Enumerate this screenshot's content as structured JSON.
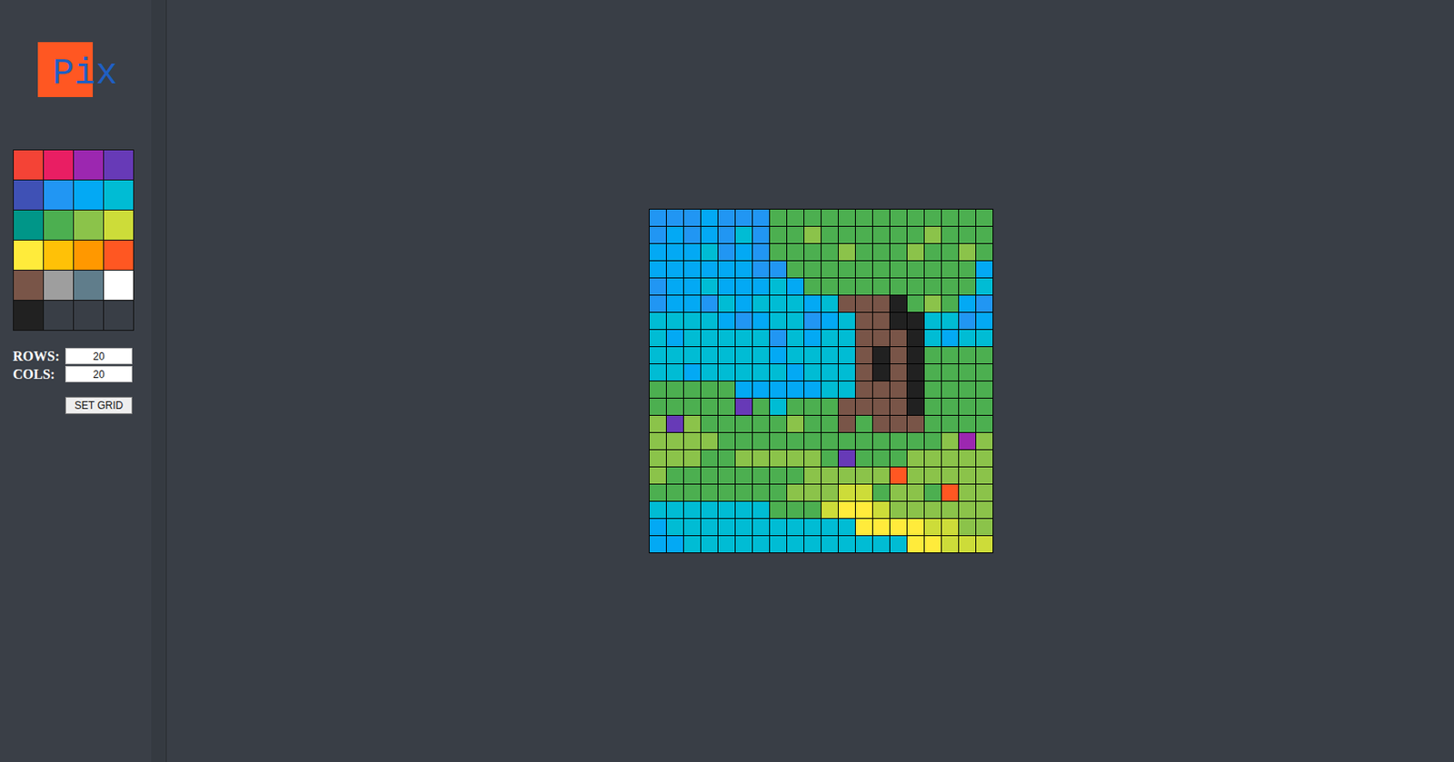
{
  "logo": {
    "text": "Pix"
  },
  "palette": [
    {
      "color": "#f44336"
    },
    {
      "color": "#e91e63"
    },
    {
      "color": "#9c27b0"
    },
    {
      "color": "#673ab7"
    },
    {
      "color": "#3f51b5"
    },
    {
      "color": "#2196f3"
    },
    {
      "color": "#03a9f4"
    },
    {
      "color": "#00bcd4"
    },
    {
      "color": "#009688"
    },
    {
      "color": "#4caf50"
    },
    {
      "color": "#8bc34a"
    },
    {
      "color": "#cddc39"
    },
    {
      "color": "#ffeb3b"
    },
    {
      "color": "#ffc107"
    },
    {
      "color": "#ff9800"
    },
    {
      "color": "#ff5722"
    },
    {
      "color": "#795548"
    },
    {
      "color": "#9e9e9e"
    },
    {
      "color": "#607d8b"
    },
    {
      "color": "#ffffff"
    },
    {
      "color": "#212121"
    },
    {
      "color": "#393e46"
    },
    {
      "color": "#393e46"
    },
    {
      "color": "#393e46"
    }
  ],
  "settings": {
    "rows_label": "ROWS:",
    "rows_value": "20",
    "cols_label": "COLS:",
    "cols_value": "20",
    "button": "SET GRID"
  },
  "grid": {
    "rows": [
      [
        "#2196f3",
        "#2196f3",
        "#2196f3",
        "#03a9f4",
        "#2196f3",
        "#2196f3",
        "#2196f3",
        "#4caf50",
        "#4caf50",
        "#4caf50",
        "#4caf50",
        "#4caf50",
        "#4caf50",
        "#4caf50",
        "#4caf50",
        "#4caf50",
        "#4caf50",
        "#4caf50",
        "#4caf50",
        "#4caf50"
      ],
      [
        "#2196f3",
        "#03a9f4",
        "#2196f3",
        "#03a9f4",
        "#2196f3",
        "#00bcd4",
        "#2196f3",
        "#4caf50",
        "#4caf50",
        "#8bc34a",
        "#4caf50",
        "#4caf50",
        "#4caf50",
        "#4caf50",
        "#4caf50",
        "#4caf50",
        "#8bc34a",
        "#4caf50",
        "#4caf50",
        "#4caf50"
      ],
      [
        "#03a9f4",
        "#03a9f4",
        "#03a9f4",
        "#00bcd4",
        "#2196f3",
        "#03a9f4",
        "#2196f3",
        "#4caf50",
        "#4caf50",
        "#4caf50",
        "#4caf50",
        "#8bc34a",
        "#4caf50",
        "#4caf50",
        "#4caf50",
        "#8bc34a",
        "#4caf50",
        "#4caf50",
        "#8bc34a",
        "#4caf50"
      ],
      [
        "#03a9f4",
        "#03a9f4",
        "#03a9f4",
        "#03a9f4",
        "#03a9f4",
        "#03a9f4",
        "#2196f3",
        "#2196f3",
        "#4caf50",
        "#4caf50",
        "#4caf50",
        "#4caf50",
        "#4caf50",
        "#4caf50",
        "#4caf50",
        "#4caf50",
        "#4caf50",
        "#4caf50",
        "#4caf50",
        "#03a9f4"
      ],
      [
        "#2196f3",
        "#03a9f4",
        "#03a9f4",
        "#00bcd4",
        "#03a9f4",
        "#03a9f4",
        "#03a9f4",
        "#00bcd4",
        "#03a9f4",
        "#4caf50",
        "#4caf50",
        "#4caf50",
        "#4caf50",
        "#4caf50",
        "#4caf50",
        "#4caf50",
        "#4caf50",
        "#4caf50",
        "#4caf50",
        "#00bcd4"
      ],
      [
        "#2196f3",
        "#03a9f4",
        "#03a9f4",
        "#2196f3",
        "#00bcd4",
        "#03a9f4",
        "#00bcd4",
        "#00bcd4",
        "#00bcd4",
        "#03a9f4",
        "#00bcd4",
        "#795548",
        "#795548",
        "#795548",
        "#212121",
        "#4caf50",
        "#8bc34a",
        "#4caf50",
        "#03a9f4",
        "#2196f3"
      ],
      [
        "#00bcd4",
        "#00bcd4",
        "#00bcd4",
        "#00bcd4",
        "#03a9f4",
        "#2196f3",
        "#03a9f4",
        "#00bcd4",
        "#00bcd4",
        "#2196f3",
        "#03a9f4",
        "#00bcd4",
        "#795548",
        "#795548",
        "#212121",
        "#212121",
        "#00bcd4",
        "#00bcd4",
        "#2196f3",
        "#03a9f4"
      ],
      [
        "#00bcd4",
        "#03a9f4",
        "#00bcd4",
        "#00bcd4",
        "#00bcd4",
        "#00bcd4",
        "#00bcd4",
        "#2196f3",
        "#00bcd4",
        "#03a9f4",
        "#00bcd4",
        "#00bcd4",
        "#795548",
        "#795548",
        "#795548",
        "#212121",
        "#00bcd4",
        "#03a9f4",
        "#00bcd4",
        "#00bcd4"
      ],
      [
        "#00bcd4",
        "#00bcd4",
        "#00bcd4",
        "#00bcd4",
        "#00bcd4",
        "#00bcd4",
        "#00bcd4",
        "#03a9f4",
        "#00bcd4",
        "#00bcd4",
        "#00bcd4",
        "#00bcd4",
        "#795548",
        "#212121",
        "#795548",
        "#212121",
        "#4caf50",
        "#4caf50",
        "#4caf50",
        "#4caf50"
      ],
      [
        "#00bcd4",
        "#00bcd4",
        "#03a9f4",
        "#00bcd4",
        "#00bcd4",
        "#00bcd4",
        "#00bcd4",
        "#00bcd4",
        "#03a9f4",
        "#00bcd4",
        "#00bcd4",
        "#00bcd4",
        "#795548",
        "#212121",
        "#795548",
        "#212121",
        "#4caf50",
        "#4caf50",
        "#4caf50",
        "#4caf50"
      ],
      [
        "#4caf50",
        "#4caf50",
        "#4caf50",
        "#4caf50",
        "#4caf50",
        "#03a9f4",
        "#03a9f4",
        "#03a9f4",
        "#03a9f4",
        "#03a9f4",
        "#00bcd4",
        "#00bcd4",
        "#795548",
        "#795548",
        "#795548",
        "#212121",
        "#4caf50",
        "#4caf50",
        "#4caf50",
        "#4caf50"
      ],
      [
        "#4caf50",
        "#4caf50",
        "#4caf50",
        "#4caf50",
        "#4caf50",
        "#673ab7",
        "#4caf50",
        "#00bcd4",
        "#4caf50",
        "#4caf50",
        "#4caf50",
        "#795548",
        "#795548",
        "#795548",
        "#795548",
        "#212121",
        "#4caf50",
        "#4caf50",
        "#4caf50",
        "#4caf50"
      ],
      [
        "#8bc34a",
        "#673ab7",
        "#8bc34a",
        "#4caf50",
        "#4caf50",
        "#4caf50",
        "#4caf50",
        "#4caf50",
        "#8bc34a",
        "#4caf50",
        "#4caf50",
        "#795548",
        "#4caf50",
        "#795548",
        "#795548",
        "#795548",
        "#4caf50",
        "#4caf50",
        "#4caf50",
        "#4caf50"
      ],
      [
        "#8bc34a",
        "#8bc34a",
        "#8bc34a",
        "#8bc34a",
        "#4caf50",
        "#4caf50",
        "#4caf50",
        "#4caf50",
        "#4caf50",
        "#4caf50",
        "#4caf50",
        "#4caf50",
        "#4caf50",
        "#4caf50",
        "#4caf50",
        "#4caf50",
        "#4caf50",
        "#8bc34a",
        "#9c27b0",
        "#8bc34a"
      ],
      [
        "#8bc34a",
        "#8bc34a",
        "#8bc34a",
        "#4caf50",
        "#4caf50",
        "#8bc34a",
        "#8bc34a",
        "#8bc34a",
        "#8bc34a",
        "#8bc34a",
        "#4caf50",
        "#673ab7",
        "#4caf50",
        "#4caf50",
        "#4caf50",
        "#8bc34a",
        "#8bc34a",
        "#8bc34a",
        "#8bc34a",
        "#8bc34a"
      ],
      [
        "#8bc34a",
        "#4caf50",
        "#4caf50",
        "#4caf50",
        "#4caf50",
        "#4caf50",
        "#4caf50",
        "#4caf50",
        "#4caf50",
        "#8bc34a",
        "#8bc34a",
        "#8bc34a",
        "#8bc34a",
        "#8bc34a",
        "#ff5722",
        "#8bc34a",
        "#8bc34a",
        "#8bc34a",
        "#8bc34a",
        "#8bc34a"
      ],
      [
        "#4caf50",
        "#4caf50",
        "#4caf50",
        "#4caf50",
        "#4caf50",
        "#4caf50",
        "#4caf50",
        "#4caf50",
        "#8bc34a",
        "#8bc34a",
        "#8bc34a",
        "#cddc39",
        "#cddc39",
        "#4caf50",
        "#8bc34a",
        "#8bc34a",
        "#4caf50",
        "#ff5722",
        "#8bc34a",
        "#8bc34a"
      ],
      [
        "#00bcd4",
        "#00bcd4",
        "#00bcd4",
        "#00bcd4",
        "#00bcd4",
        "#00bcd4",
        "#00bcd4",
        "#4caf50",
        "#4caf50",
        "#4caf50",
        "#cddc39",
        "#ffeb3b",
        "#ffeb3b",
        "#cddc39",
        "#8bc34a",
        "#8bc34a",
        "#8bc34a",
        "#8bc34a",
        "#8bc34a",
        "#8bc34a"
      ],
      [
        "#03a9f4",
        "#00bcd4",
        "#00bcd4",
        "#00bcd4",
        "#00bcd4",
        "#00bcd4",
        "#00bcd4",
        "#00bcd4",
        "#00bcd4",
        "#00bcd4",
        "#00bcd4",
        "#00bcd4",
        "#ffeb3b",
        "#ffeb3b",
        "#ffeb3b",
        "#ffeb3b",
        "#cddc39",
        "#cddc39",
        "#8bc34a",
        "#8bc34a"
      ],
      [
        "#03a9f4",
        "#03a9f4",
        "#00bcd4",
        "#00bcd4",
        "#00bcd4",
        "#00bcd4",
        "#00bcd4",
        "#00bcd4",
        "#00bcd4",
        "#00bcd4",
        "#00bcd4",
        "#00bcd4",
        "#00bcd4",
        "#00bcd4",
        "#00bcd4",
        "#ffeb3b",
        "#ffeb3b",
        "#cddc39",
        "#cddc39",
        "#cddc39"
      ]
    ]
  }
}
